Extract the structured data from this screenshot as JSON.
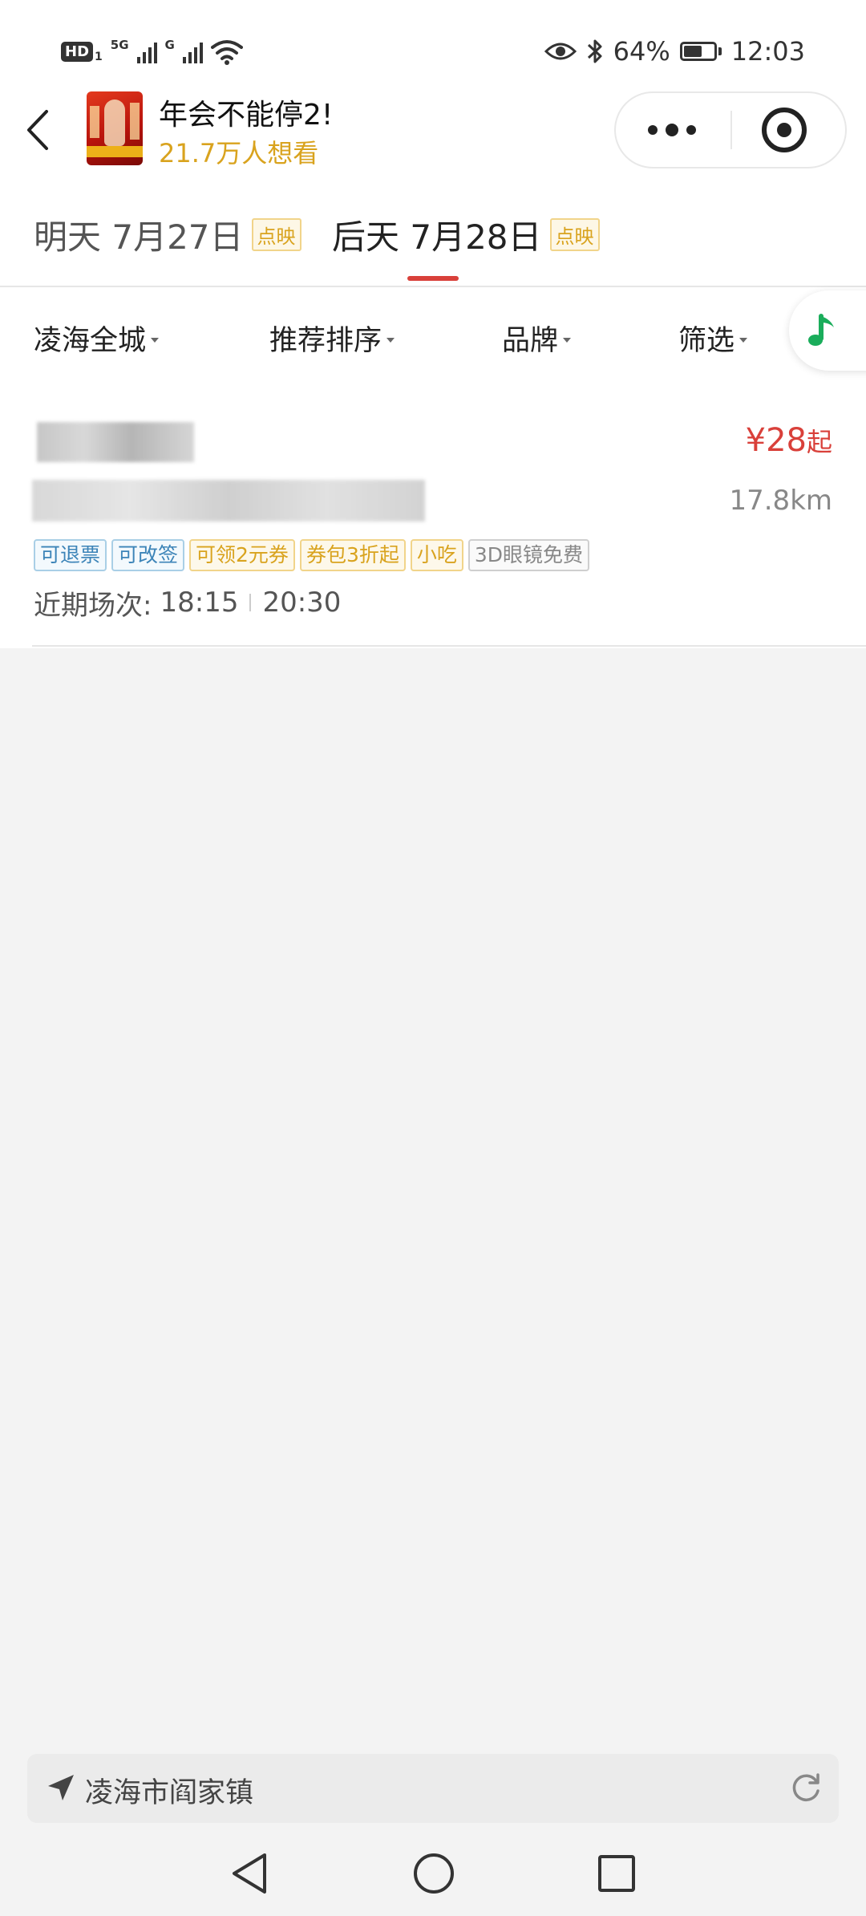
{
  "status_bar": {
    "hd_label": "HD",
    "hd_sim": "1",
    "net1_label": "5G",
    "net2_label": "G",
    "battery_text": "64%",
    "battery_level": 0.64,
    "time": "12:03"
  },
  "header": {
    "back_icon": "chevron-left-icon",
    "movie_title": "年会不能停2!",
    "want_to_see": "21.7万人想看"
  },
  "date_tabs": [
    {
      "label": "明天 7月27日",
      "badge": "点映",
      "active": false
    },
    {
      "label": "后天 7月28日",
      "badge": "点映",
      "active": true
    }
  ],
  "filters": [
    {
      "label": "凌海全城"
    },
    {
      "label": "推荐排序"
    },
    {
      "label": "品牌"
    },
    {
      "label": "筛选"
    }
  ],
  "cinema": {
    "price_value": "¥28",
    "price_suffix": "起",
    "distance": "17.8km",
    "tags": [
      {
        "text": "可退票",
        "style": "blue"
      },
      {
        "text": "可改签",
        "style": "blue"
      },
      {
        "text": "可领2元券",
        "style": "orange"
      },
      {
        "text": "券包3折起",
        "style": "orange"
      },
      {
        "text": "小吃",
        "style": "orange"
      },
      {
        "text": "3D眼镜免费",
        "style": "gray"
      }
    ],
    "showtimes_label": "近期场次:",
    "showtimes": [
      "18:15",
      "20:30"
    ]
  },
  "location": {
    "text": "凌海市阎家镇"
  },
  "colors": {
    "accent_red": "#d9403a",
    "gold": "#d9a31e",
    "music_green": "#1aad5b",
    "background": "#f3f3f3"
  }
}
